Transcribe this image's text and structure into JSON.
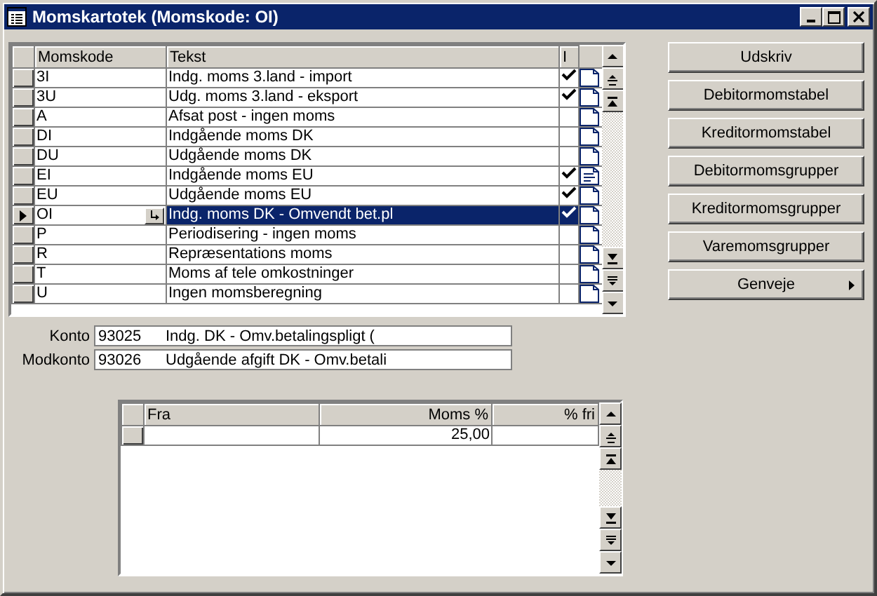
{
  "window": {
    "title": "Momskartotek (Momskode: OI)"
  },
  "vat_codes": {
    "columns": [
      "Momskode",
      "Tekst",
      "I"
    ],
    "rows": [
      {
        "code": "3I",
        "text": "Indg. moms 3.land - import",
        "checked": true,
        "has_note": false,
        "selected": false
      },
      {
        "code": "3U",
        "text": "Udg. moms 3.land - eksport",
        "checked": true,
        "has_note": false,
        "selected": false
      },
      {
        "code": "A",
        "text": "Afsat post - ingen moms",
        "checked": false,
        "has_note": false,
        "selected": false
      },
      {
        "code": "DI",
        "text": "Indgående moms DK",
        "checked": false,
        "has_note": false,
        "selected": false
      },
      {
        "code": "DU",
        "text": "Udgående moms DK",
        "checked": false,
        "has_note": false,
        "selected": false
      },
      {
        "code": "EI",
        "text": "Indgående moms EU",
        "checked": true,
        "has_note": true,
        "selected": false
      },
      {
        "code": "EU",
        "text": "Udgående moms EU",
        "checked": true,
        "has_note": false,
        "selected": false
      },
      {
        "code": "OI",
        "text": "Indg. moms DK - Omvendt bet.pl",
        "checked": true,
        "has_note": false,
        "selected": true
      },
      {
        "code": "P",
        "text": "Periodisering - ingen moms",
        "checked": false,
        "has_note": false,
        "selected": false
      },
      {
        "code": "R",
        "text": "Repræsentations moms",
        "checked": false,
        "has_note": false,
        "selected": false
      },
      {
        "code": "T",
        "text": "Moms af tele omkostninger",
        "checked": false,
        "has_note": false,
        "selected": false
      },
      {
        "code": "U",
        "text": "Ingen momsberegning",
        "checked": false,
        "has_note": false,
        "selected": false
      }
    ]
  },
  "accounts": [
    {
      "label": "Konto",
      "number": "93025",
      "name": "Indg. DK - Omv.betalingspligt ("
    },
    {
      "label": "Modkonto",
      "number": "93026",
      "name": "Udgående afgift DK - Omv.betali"
    }
  ],
  "rates": {
    "columns": [
      "Fra",
      "Moms %",
      "% fri"
    ],
    "rows": [
      {
        "moms_pct": "25,00"
      }
    ]
  },
  "buttons": [
    {
      "label": "Udskriv",
      "submenu": false
    },
    {
      "label": "Debitormomstabel",
      "submenu": false
    },
    {
      "label": "Kreditormomstabel",
      "submenu": false
    },
    {
      "label": "Debitormomsgrupper",
      "submenu": false
    },
    {
      "label": "Kreditormomsgrupper",
      "submenu": false
    },
    {
      "label": "Varemomsgrupper",
      "submenu": false
    },
    {
      "label": "Genveje",
      "submenu": true
    }
  ]
}
